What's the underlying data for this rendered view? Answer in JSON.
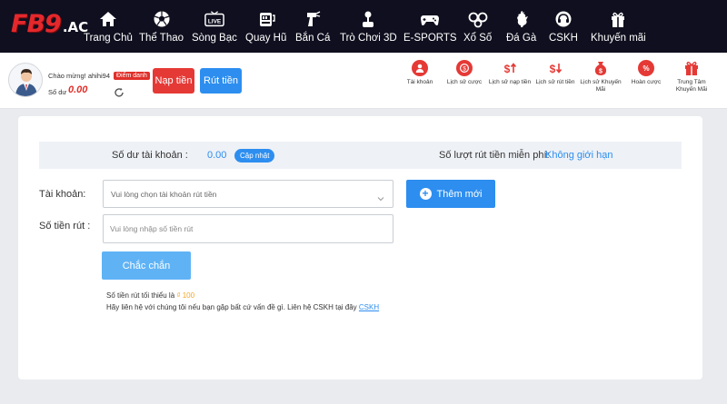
{
  "logo": {
    "main": "FB9",
    "suffix": ".AC"
  },
  "nav": [
    {
      "label": "Trang Chủ",
      "icon": "home-icon"
    },
    {
      "label": "Thể Thao",
      "icon": "soccer-ball-icon"
    },
    {
      "label": "Sòng Bạc",
      "icon": "live-casino-icon"
    },
    {
      "label": "Quay Hũ",
      "icon": "slot-machine-icon"
    },
    {
      "label": "Bắn Cá",
      "icon": "fish-gun-icon"
    },
    {
      "label": "Trò Chơi 3D",
      "icon": "joystick-icon"
    },
    {
      "label": "E-SPORTS",
      "icon": "gamepad-icon"
    },
    {
      "label": "Xổ Số",
      "icon": "lottery-balls-icon"
    },
    {
      "label": "Đá Gà",
      "icon": "rooster-icon"
    },
    {
      "label": "CSKH",
      "icon": "support-headset-icon"
    },
    {
      "label": "Khuyến mãi",
      "icon": "gift-icon"
    }
  ],
  "user": {
    "greeting": "Chào mừng!",
    "username": "ahihi94",
    "checkin_badge": "Điểm danh",
    "balance_label": "Số dư",
    "balance_value": "0.00"
  },
  "actions": {
    "deposit": "Nạp tiền",
    "withdraw": "Rút tiền"
  },
  "quick_links": [
    {
      "label": "Tài khoản",
      "icon": "account-icon"
    },
    {
      "label": "Lịch sử cược",
      "icon": "bet-history-icon"
    },
    {
      "label": "Lịch sử nạp tiền",
      "icon": "deposit-history-icon"
    },
    {
      "label": "Lịch sử rút tiền",
      "icon": "withdraw-history-icon"
    },
    {
      "label": "Lịch sử Khuyến Mãi",
      "icon": "promo-history-icon"
    },
    {
      "label": "Hoàn cược",
      "icon": "rebate-icon"
    },
    {
      "label": "Trung Tâm Khuyến Mãi",
      "icon": "promo-center-icon"
    }
  ],
  "form": {
    "balance_label": "Số dư tài khoản :",
    "balance_value": "0.00",
    "update_button": "Cập nhật",
    "free_withdraw_label": "Số lượt rút tiền miễn phí:",
    "free_withdraw_value": "Không giới hạn",
    "account_label": "Tài khoản:",
    "account_placeholder": "Vui lòng chọn tài khoản rút tiền",
    "add_button": "Thêm mới",
    "amount_label": "Số tiền rút :",
    "amount_placeholder": "Vui lòng nhập số tiền rút",
    "confirm_button": "Chắc chắn",
    "note_min_prefix": "Số tiền rút tối thiểu là",
    "note_min_amount": "₫ 100",
    "note_contact": "Hãy liên hệ với chúng tôi nếu bạn gặp bất cứ vấn đề gì. Liên hệ CSKH tại đây",
    "note_link": "CSKH"
  },
  "colors": {
    "nav_bg": "#0f0f1f",
    "brand_red": "#e53935",
    "brand_blue": "#2d8ef0",
    "logo_red": "#e4282c"
  }
}
